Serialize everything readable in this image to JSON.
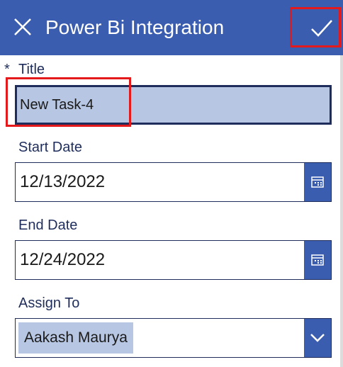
{
  "header": {
    "title": "Power Bi Integration",
    "close_icon": "close-icon",
    "confirm_icon": "checkmark-icon",
    "background": "#3b5db0"
  },
  "form": {
    "title_field": {
      "required_marker": "*",
      "label": "Title",
      "value": "New Task-4"
    },
    "start_date": {
      "label": "Start Date",
      "value": "12/13/2022",
      "icon": "calendar-icon"
    },
    "end_date": {
      "label": "End Date",
      "value": "12/24/2022",
      "icon": "calendar-icon"
    },
    "assign_to": {
      "label": "Assign To",
      "value": "Aakash Maurya",
      "icon": "chevron-down-icon"
    }
  },
  "colors": {
    "accent": "#3b5db0",
    "input_fill": "#b7c6e3",
    "label_text": "#1f2d5c",
    "annotation": "#e3191c"
  }
}
